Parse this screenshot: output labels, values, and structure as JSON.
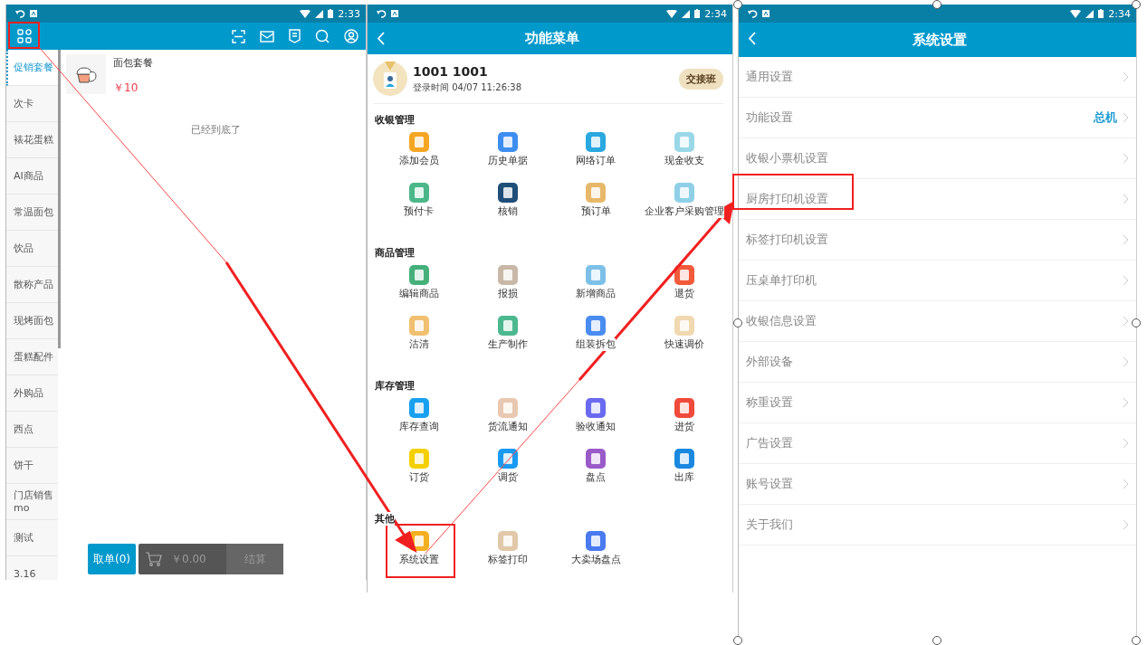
{
  "sales_screen": {
    "status_time": "2:33",
    "categories": [
      {
        "label": "促销套餐",
        "selected": true
      },
      {
        "label": "次卡",
        "selected": false
      },
      {
        "label": "裱花蛋糕",
        "selected": false
      },
      {
        "label": "AI商品",
        "selected": false
      },
      {
        "label": "常温面包",
        "selected": false
      },
      {
        "label": "饮品",
        "selected": false
      },
      {
        "label": "散称产品",
        "selected": false
      },
      {
        "label": "现烤面包",
        "selected": false
      },
      {
        "label": "蛋糕配件",
        "selected": false
      },
      {
        "label": "外购品",
        "selected": false
      },
      {
        "label": "西点",
        "selected": false
      },
      {
        "label": "饼干",
        "selected": false
      },
      {
        "label": "门店销售mo",
        "selected": false
      },
      {
        "label": "测试",
        "selected": false
      },
      {
        "label": "3.16",
        "selected": false
      }
    ],
    "products": [
      {
        "name": "面包套餐",
        "price": "￥10"
      }
    ],
    "list_end": "已经到底了",
    "cancel_button": "取单(0)",
    "cart_total": "￥0.00",
    "checkout_button": "结算"
  },
  "function_menu": {
    "status_time": "2:34",
    "title": "功能菜单",
    "user": {
      "name": "1001 1001",
      "login_time": "登录时间 04/07 11:26:38"
    },
    "shift_button": "交接班",
    "sections": [
      {
        "title": "收银管理",
        "items": [
          {
            "label": "添加会员",
            "color": "#f5a623"
          },
          {
            "label": "历史单据",
            "color": "#3d8ef0"
          },
          {
            "label": "网络订单",
            "color": "#2aa8e0"
          },
          {
            "label": "现金收支",
            "color": "#9ad8e8"
          },
          {
            "label": "预付卡",
            "color": "#4cb88a"
          },
          {
            "label": "核销",
            "color": "#1f4e79"
          },
          {
            "label": "预订单",
            "color": "#e8b86a"
          },
          {
            "label": "企业客户采购管理",
            "color": "#8fd0e8"
          }
        ]
      },
      {
        "title": "商品管理",
        "items": [
          {
            "label": "编辑商品",
            "color": "#45b07a"
          },
          {
            "label": "报损",
            "color": "#c9b8a8"
          },
          {
            "label": "新增商品",
            "color": "#7cc0e8"
          },
          {
            "label": "退货",
            "color": "#f25a3a"
          },
          {
            "label": "沽清",
            "color": "#f0c070"
          },
          {
            "label": "生产制作",
            "color": "#4cb890"
          },
          {
            "label": "组装拆包",
            "color": "#4a8cf0"
          },
          {
            "label": "快速调价",
            "color": "#f0d8b0"
          }
        ]
      },
      {
        "title": "库存管理",
        "items": [
          {
            "label": "库存查询",
            "color": "#1aa0f0"
          },
          {
            "label": "货流通知",
            "color": "#e8c8b0"
          },
          {
            "label": "验收通知",
            "color": "#6a6af0"
          },
          {
            "label": "进货",
            "color": "#f04a3a"
          },
          {
            "label": "订货",
            "color": "#f5d000"
          },
          {
            "label": "调货",
            "color": "#1a9af0"
          },
          {
            "label": "盘点",
            "color": "#9a5ac8"
          },
          {
            "label": "出库",
            "color": "#1a88e0"
          }
        ]
      },
      {
        "title": "其他",
        "items": [
          {
            "label": "系统设置",
            "color": "#f5b020"
          },
          {
            "label": "标签打印",
            "color": "#e0c8a8"
          },
          {
            "label": "大卖场盘点",
            "color": "#4a7af0"
          }
        ]
      }
    ]
  },
  "system_settings": {
    "status_time": "2:34",
    "title": "系统设置",
    "rows": [
      {
        "label": "通用设置"
      },
      {
        "label": "功能设置",
        "value": "总机"
      },
      {
        "label": "收银小票机设置"
      },
      {
        "label": "厨房打印机设置"
      },
      {
        "label": "标签打印机设置"
      },
      {
        "label": "压桌单打印机"
      },
      {
        "label": "收银信息设置"
      },
      {
        "label": "外部设备"
      },
      {
        "label": "称重设置"
      },
      {
        "label": "广告设置"
      },
      {
        "label": "账号设置"
      },
      {
        "label": "关于我们"
      }
    ]
  }
}
